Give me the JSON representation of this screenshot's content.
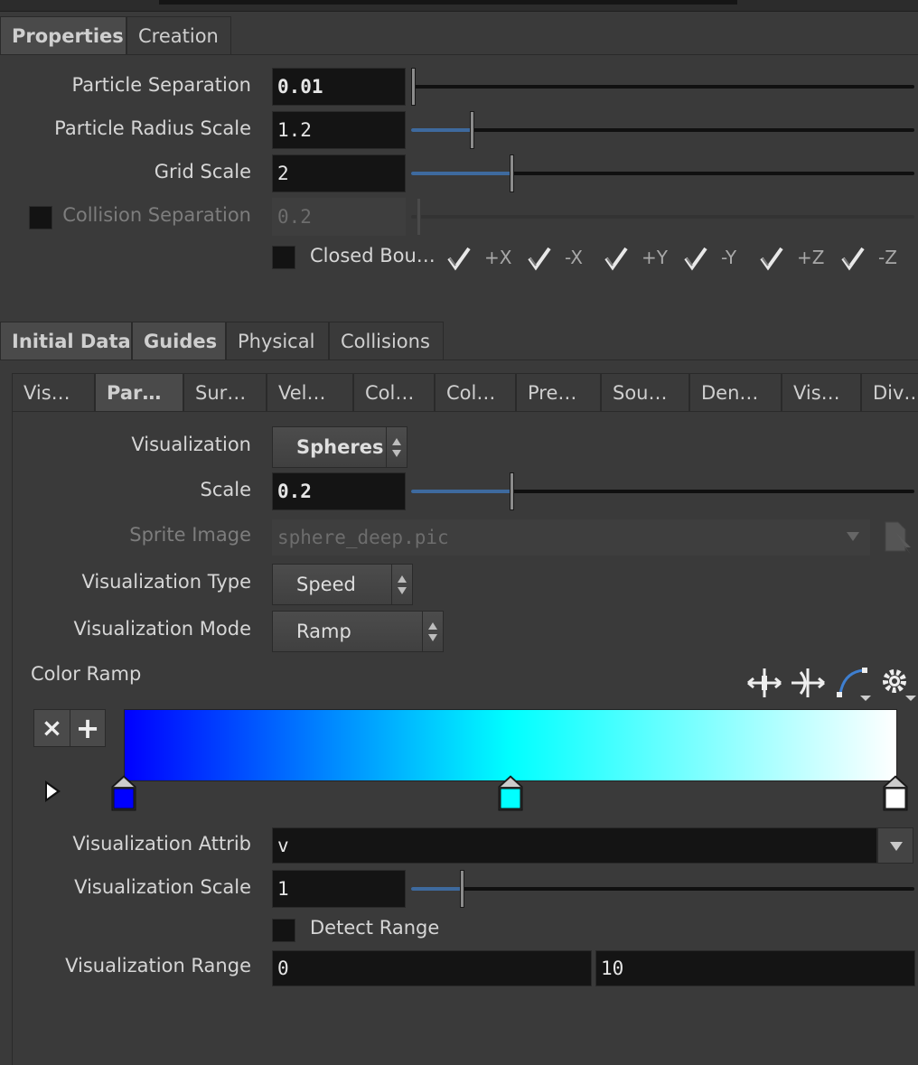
{
  "top_tabs": [
    "Properties",
    "Creation"
  ],
  "particle_separation": {
    "label": "Particle Separation",
    "value": "0.01",
    "slider_fraction": 0.0
  },
  "particle_radius_scale": {
    "label": "Particle Radius Scale",
    "value": "1.2",
    "slider_fraction": 0.12
  },
  "grid_scale": {
    "label": "Grid Scale",
    "value": "2",
    "slider_fraction": 0.2
  },
  "collision_separation": {
    "label": "Collision Separation",
    "value": "0.2",
    "enabled": false
  },
  "closed_boundaries": {
    "label": "Closed Bou…",
    "axes": [
      "+X",
      "-X",
      "+Y",
      "-Y",
      "+Z",
      "-Z"
    ]
  },
  "section_tabs": [
    "Initial Data",
    "Guides",
    "Physical",
    "Collisions"
  ],
  "sub_tabs": [
    "Vis…",
    "Par…",
    "Sur…",
    "Vel…",
    "Col…",
    "Col…",
    "Pre…",
    "Sou…",
    "Den…",
    "Vis…",
    "Div…"
  ],
  "visualization": {
    "label": "Visualization",
    "value": "Spheres"
  },
  "scale": {
    "label": "Scale",
    "value": "0.2",
    "slider_fraction": 0.2
  },
  "sprite_image": {
    "label": "Sprite Image",
    "value": "sphere_deep.pic"
  },
  "visualization_type": {
    "label": "Visualization Type",
    "value": "Speed"
  },
  "visualization_mode": {
    "label": "Visualization Mode",
    "value": "Ramp"
  },
  "color_ramp": {
    "label": "Color Ramp",
    "keys": [
      {
        "position": 0.0,
        "color": "#0000ff"
      },
      {
        "position": 0.5,
        "color": "#00ffff"
      },
      {
        "position": 1.0,
        "color": "#ffffff"
      }
    ],
    "delete_label": "×",
    "add_label": "+"
  },
  "visualization_attrib": {
    "label": "Visualization Attrib",
    "value": "v"
  },
  "visualization_scale": {
    "label": "Visualization Scale",
    "value": "1",
    "slider_fraction": 0.1
  },
  "detect_range": {
    "label": "Detect Range"
  },
  "visualization_range": {
    "label": "Visualization Range",
    "min": "0",
    "max": "10"
  },
  "colors": {
    "accent": "#3e6a9e",
    "background": "#3a3a3a",
    "field": "#141414"
  }
}
